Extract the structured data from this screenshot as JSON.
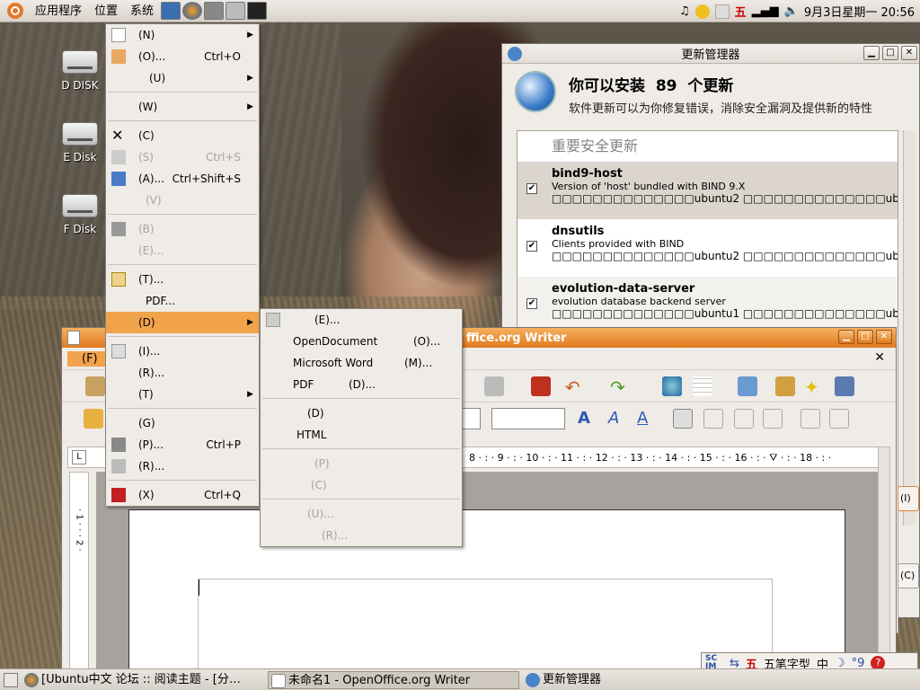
{
  "top_panel": {
    "menus": [
      "应用程序",
      "位置",
      "系统"
    ],
    "clock": "9月3日星期一 20:56",
    "tray_labels": {
      "ime": "五"
    }
  },
  "desktop_icons": [
    "D DISK",
    "E Disk",
    "F Disk"
  ],
  "update_manager": {
    "title": "更新管理器",
    "heading_prefix": "你可以安装",
    "count": "89",
    "heading_suffix": "个更新",
    "subtitle": "软件更新可以为你修复错误，消除安全漏洞及提供新的特性",
    "category": "重要安全更新",
    "packages": [
      {
        "name": "bind9-host",
        "desc": "Version of 'host' bundled with BIND 9.X",
        "versions": "□□□□□□□□□□□□□□ubuntu2 □□□□□□□□□□□□□□ubuntu2.1 (□□□",
        "checked": "✔"
      },
      {
        "name": "dnsutils",
        "desc": "Clients provided with BIND",
        "versions": "□□□□□□□□□□□□□□ubuntu2 □□□□□□□□□□□□□□ubuntu2.1 (□□□",
        "checked": "✔"
      },
      {
        "name": "evolution-data-server",
        "desc": "evolution database backend server",
        "versions": "□□□□□□□□□□□□□□ubuntu1 □□□□□□□□□□□□□□ubuntu1.1 (□□□□",
        "checked": "✔"
      }
    ],
    "side_button_1": "(I)",
    "side_button_2": "(C)"
  },
  "writer": {
    "title": "ffice.org Writer",
    "menu_file": "(F)",
    "ruler_text": "8 · : · 9 · : · 10 · : · 11 · : · 12 · : · 13 · : · 14 · : · 15 · : · 16 · : · ⛛ · : · 18 · : ·",
    "vruler_text": "· 1 · · · 2 ·"
  },
  "file_menu": {
    "items": [
      {
        "label": "(N)",
        "accel": "",
        "submenu": true,
        "disabled": false
      },
      {
        "label": "(O)...",
        "accel": "Ctrl+O",
        "submenu": false,
        "disabled": false
      },
      {
        "label": "(U)",
        "accel": "",
        "submenu": true,
        "disabled": false
      },
      {
        "label": "(W)",
        "accel": "",
        "submenu": true,
        "disabled": false
      },
      {
        "label": "(C)",
        "accel": "",
        "submenu": false,
        "disabled": false
      },
      {
        "label": "(S)",
        "accel": "Ctrl+S",
        "submenu": false,
        "disabled": true
      },
      {
        "label": "(A)...",
        "accel": "Ctrl+Shift+S",
        "submenu": false,
        "disabled": false
      },
      {
        "label": "(V)",
        "accel": "",
        "submenu": false,
        "disabled": true
      },
      {
        "label": "(B)",
        "accel": "",
        "submenu": false,
        "disabled": true
      },
      {
        "label": "(E)...",
        "accel": "",
        "submenu": false,
        "disabled": true
      },
      {
        "label": "(T)...",
        "accel": "",
        "submenu": false,
        "disabled": false
      },
      {
        "label": "PDF...",
        "accel": "",
        "submenu": false,
        "disabled": false
      },
      {
        "label": "(D)",
        "accel": "",
        "submenu": true,
        "disabled": false
      },
      {
        "label": "(I)...",
        "accel": "",
        "submenu": false,
        "disabled": false
      },
      {
        "label": "(R)...",
        "accel": "",
        "submenu": false,
        "disabled": false
      },
      {
        "label": "(T)",
        "accel": "",
        "submenu": true,
        "disabled": false
      },
      {
        "label": "(G)",
        "accel": "",
        "submenu": false,
        "disabled": false
      },
      {
        "label": "(P)...",
        "accel": "Ctrl+P",
        "submenu": false,
        "disabled": false
      },
      {
        "label": "(R)...",
        "accel": "",
        "submenu": false,
        "disabled": false
      },
      {
        "label": "(X)",
        "accel": "Ctrl+Q",
        "submenu": false,
        "disabled": false
      }
    ]
  },
  "send_submenu": {
    "items": [
      {
        "label": "(E)...",
        "disabled": false
      },
      {
        "label": "OpenDocument",
        "accel": "(O)...",
        "disabled": false
      },
      {
        "label": "Microsoft Word",
        "accel": "(M)...",
        "disabled": false
      },
      {
        "label": "PDF",
        "accel": "(D)...",
        "disabled": false
      },
      {
        "label": "(D)",
        "disabled": false
      },
      {
        "label": "HTML",
        "disabled": false
      },
      {
        "label": "(P)",
        "disabled": true
      },
      {
        "label": "(C)",
        "disabled": true
      },
      {
        "label": "(U)...",
        "disabled": true
      },
      {
        "label": "(R)...",
        "disabled": true
      }
    ]
  },
  "taskbar": {
    "tasks": [
      "[Ubuntu中文 论坛 :: 阅读主题 - [分…",
      "未命名1 - OpenOffice.org Writer",
      "更新管理器"
    ]
  },
  "im_bar": {
    "logo": "SC IM",
    "mode": "五笔字型",
    "lang": "中",
    "punct": "°9"
  },
  "colors": {
    "highlight": "#f0a34a",
    "writer_title": "#e07a1e"
  }
}
